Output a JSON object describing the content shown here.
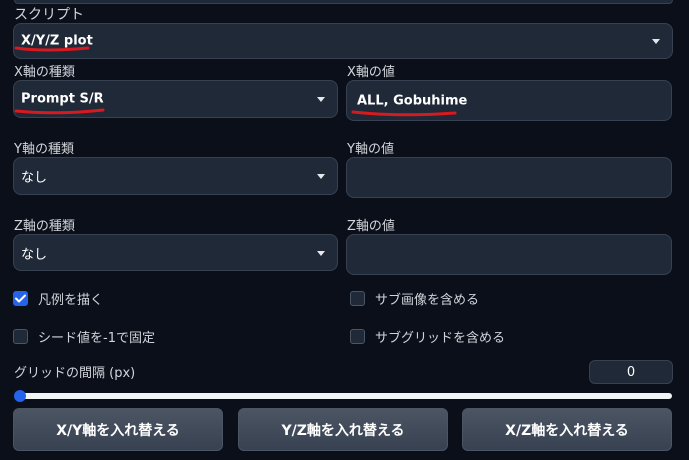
{
  "script": {
    "label": "スクリプト",
    "selected": "X/Y/Z plot"
  },
  "x_axis": {
    "type_label": "X軸の種類",
    "type_value": "Prompt S/R",
    "values_label": "X軸の値",
    "values_value": "ALL, Gobuhime"
  },
  "y_axis": {
    "type_label": "Y軸の種類",
    "type_value": "なし",
    "values_label": "Y軸の値",
    "values_value": ""
  },
  "z_axis": {
    "type_label": "Z軸の種類",
    "type_value": "なし",
    "values_label": "Z軸の値",
    "values_value": ""
  },
  "checkboxes": {
    "draw_legend": {
      "label": "凡例を描く",
      "checked": true
    },
    "include_sub_images": {
      "label": "サブ画像を含める",
      "checked": false
    },
    "fixed_seed": {
      "label": "シード値を-1で固定",
      "checked": false
    },
    "include_sub_grids": {
      "label": "サブグリッドを含める",
      "checked": false
    }
  },
  "grid_margin": {
    "label": "グリッドの間隔 (px)",
    "value": "0",
    "slider_fraction": 0
  },
  "buttons": {
    "swap_xy": "X/Y軸を入れ替える",
    "swap_yz": "Y/Z軸を入れ替える",
    "swap_xz": "X/Z軸を入れ替える"
  },
  "colors": {
    "background": "#0b0f19",
    "field": "#1f2937",
    "accent": "#2563eb",
    "annotation": "#d71920"
  },
  "icons": [
    "chevron-down-icon",
    "checkmark-icon"
  ]
}
